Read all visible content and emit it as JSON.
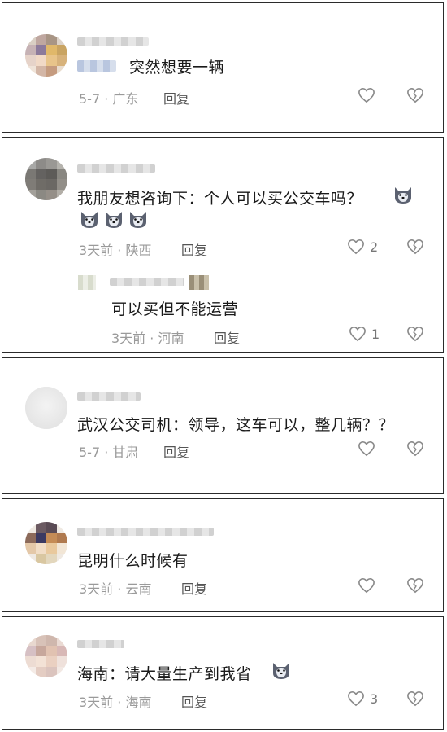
{
  "comments": [
    {
      "text": "突然想要一辆",
      "meta": "5-7 · 广东",
      "reply_label": "回复",
      "likes": ""
    },
    {
      "text": "我朋友想咨询下：个人可以买公交车吗？",
      "meta": "3天前 · 陕西",
      "reply_label": "回复",
      "likes": "2",
      "sub_reply": {
        "text": "可以买但不能运营",
        "meta": "3天前 · 河南",
        "reply_label": "回复",
        "likes": "1"
      }
    },
    {
      "text": "武汉公交司机：领导，这车可以，整几辆？？",
      "meta": "5-7 · 甘肃",
      "reply_label": "回复",
      "likes": ""
    },
    {
      "text": "昆明什么时候有",
      "meta": "3天前 · 云南",
      "reply_label": "回复",
      "likes": ""
    },
    {
      "text": "海南：请大量生产到我省",
      "meta": "3天前 · 海南",
      "reply_label": "回复",
      "likes": "3"
    }
  ],
  "icons": {
    "like": "heart-outline-icon",
    "dislike": "broken-heart-icon",
    "emoji": "husky-dog-emoji-icon"
  },
  "colors": {
    "text": "#1a1a1a",
    "meta": "#9a9a9a",
    "border": "#2b2b2b"
  }
}
